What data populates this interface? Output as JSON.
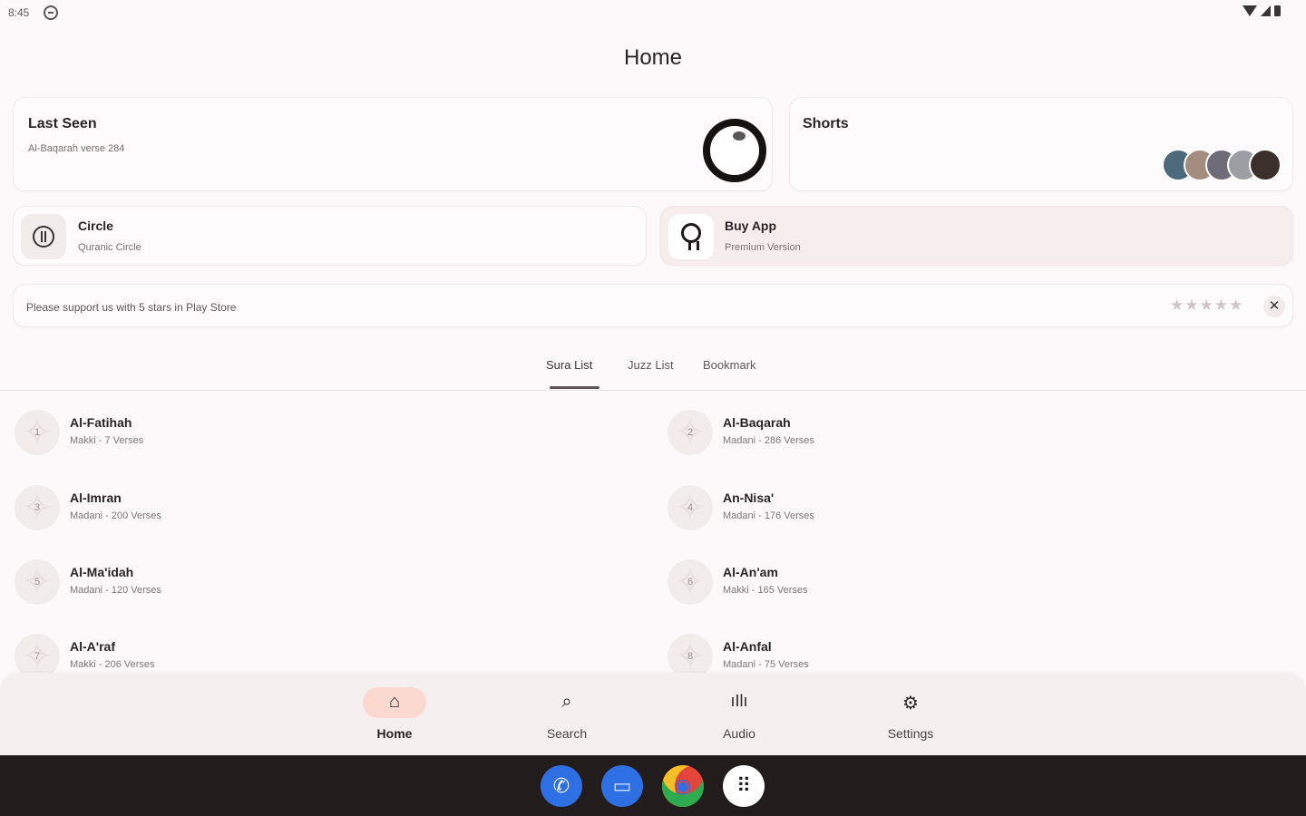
{
  "status": {
    "time": "8:45"
  },
  "title": "Home",
  "last_seen": {
    "title": "Last Seen",
    "subtitle": "Al-Baqarah verse 284"
  },
  "shorts": {
    "title": "Shorts"
  },
  "circle": {
    "title": "Circle",
    "subtitle": "Quranic Circle"
  },
  "buy": {
    "title": "Buy App",
    "subtitle": "Premium Version"
  },
  "rating": {
    "text": "Please support us with 5 stars in Play Store",
    "stars": "★★★★★",
    "close": "✕"
  },
  "tabs": [
    {
      "label": "Sura List"
    },
    {
      "label": "Juzz List"
    },
    {
      "label": "Bookmark"
    }
  ],
  "suras": [
    {
      "number": "1",
      "name": "Al-Fatihah",
      "meta": "Makki - 7 Verses"
    },
    {
      "number": "2",
      "name": "Al-Baqarah",
      "meta": "Madani - 286 Verses"
    },
    {
      "number": "3",
      "name": "Al-Imran",
      "meta": "Madani - 200 Verses"
    },
    {
      "number": "4",
      "name": "An-Nisa'",
      "meta": "Madani - 176 Verses"
    },
    {
      "number": "5",
      "name": "Al-Ma'idah",
      "meta": "Madani - 120 Verses"
    },
    {
      "number": "6",
      "name": "Al-An'am",
      "meta": "Makki - 165 Verses"
    },
    {
      "number": "7",
      "name": "Al-A'raf",
      "meta": "Makki - 206 Verses"
    },
    {
      "number": "8",
      "name": "Al-Anfal",
      "meta": "Madani - 75 Verses"
    }
  ],
  "nav": [
    {
      "label": "Home",
      "icon": "home-icon",
      "glyph": "⌂"
    },
    {
      "label": "Search",
      "icon": "search-icon",
      "glyph": "⌕"
    },
    {
      "label": "Audio",
      "icon": "audio-icon",
      "glyph": "ıIlı"
    },
    {
      "label": "Settings",
      "icon": "settings-icon",
      "glyph": "⚙"
    }
  ],
  "taskbar": [
    {
      "icon": "phone-icon",
      "glyph": "✆",
      "color": "#2f6fe4"
    },
    {
      "icon": "messages-icon",
      "glyph": "▭",
      "color": "#2f6fe4"
    },
    {
      "icon": "chrome-icon",
      "glyph": "◉",
      "color": "#e5443a"
    },
    {
      "icon": "app-drawer-icon",
      "glyph": "⠿",
      "color": "#ffffff"
    }
  ]
}
